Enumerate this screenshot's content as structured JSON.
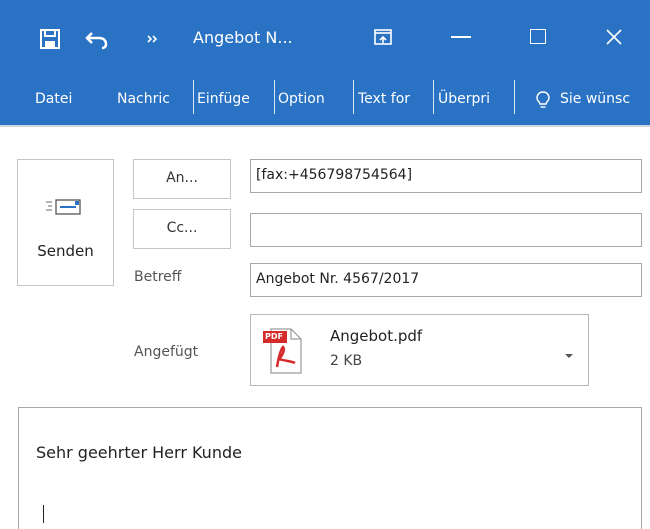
{
  "window": {
    "title": "Angebot N..."
  },
  "ribbon": {
    "tabs": [
      "Datei",
      "Nachric",
      "Einfüge",
      "Option",
      "Text for",
      "Überpri",
      "Sie wünsc"
    ]
  },
  "compose": {
    "send_label": "Senden",
    "to_button": "An...",
    "cc_button": "Cc...",
    "to_value": "[fax:+456798754564]",
    "cc_value": "",
    "subject_label": "Betreff",
    "subject_value": "Angebot Nr. 4567/2017",
    "attached_label": "Angefügt",
    "attachment": {
      "filename": "Angebot.pdf",
      "size": "2 KB",
      "badge": "PDF"
    }
  },
  "message": {
    "greeting": "Sehr geehrter Herr Kunde"
  },
  "colors": {
    "accent": "#2a72c4",
    "pdf_red": "#d42a2a"
  }
}
